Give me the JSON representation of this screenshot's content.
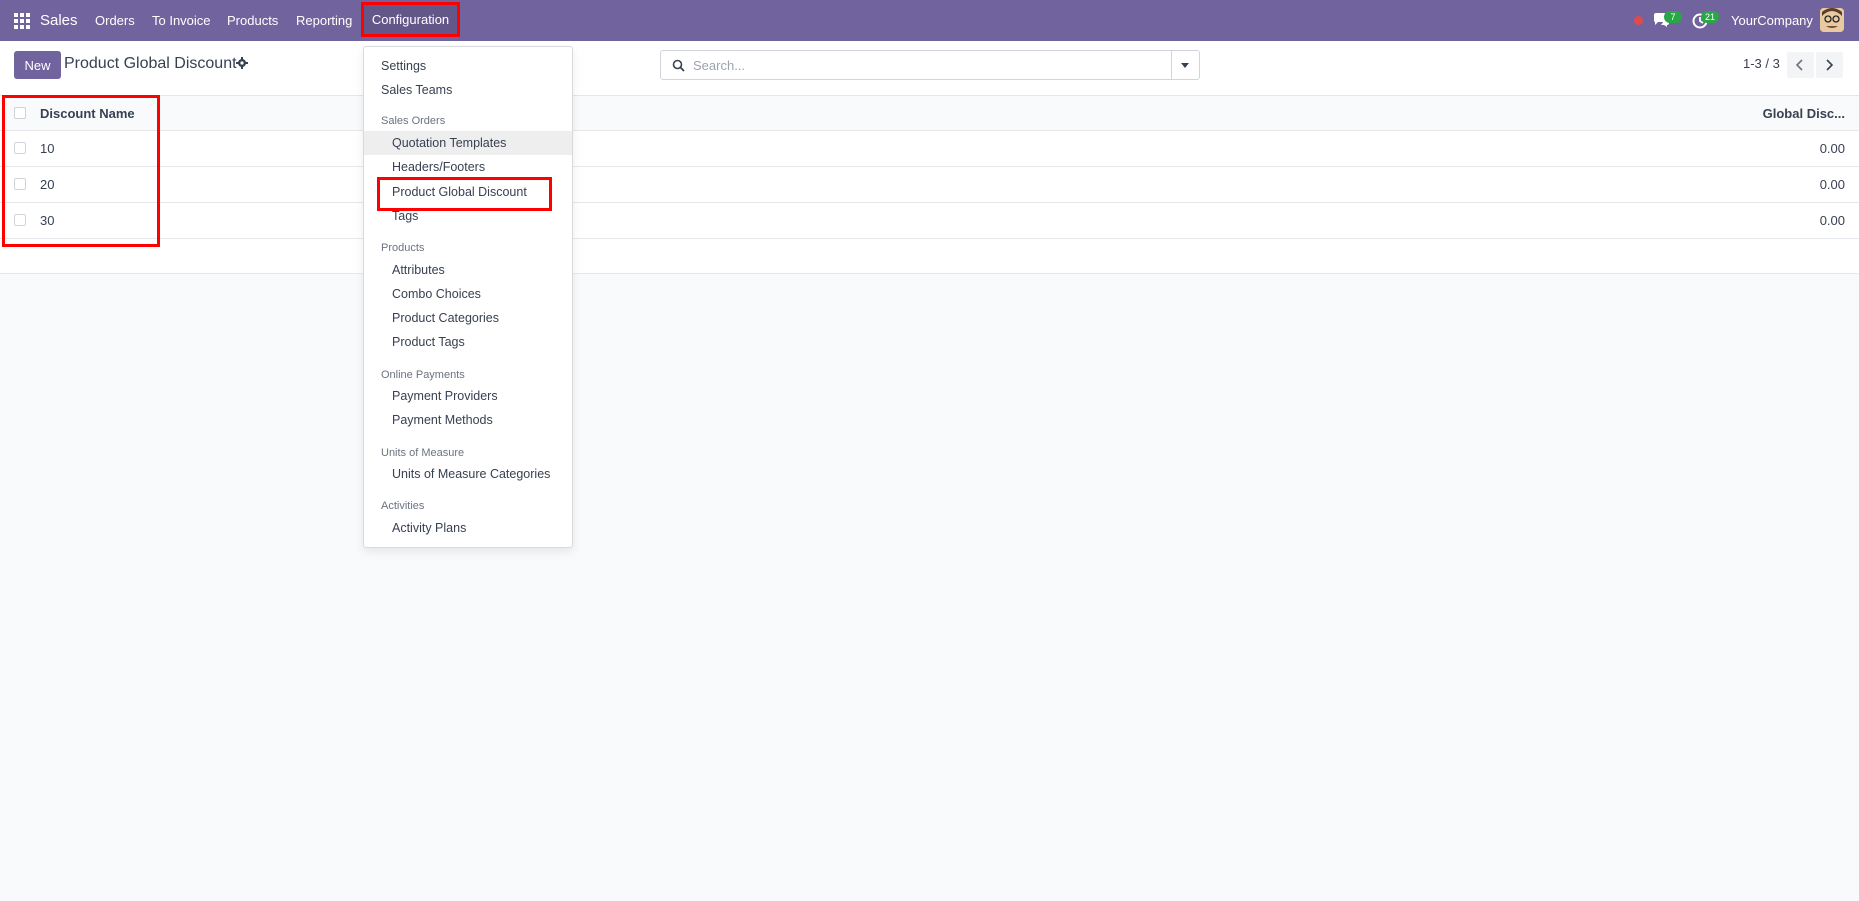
{
  "navbar": {
    "brand": "Sales",
    "menu": [
      "Orders",
      "To Invoice",
      "Products",
      "Reporting"
    ],
    "config_label": "Configuration",
    "chat_count": "7",
    "activity_count": "21",
    "company": "YourCompany"
  },
  "control": {
    "new_label": "New",
    "title": "Product Global Discount",
    "search_placeholder": "Search...",
    "pager": "1-3 / 3"
  },
  "table": {
    "columns": [
      "Discount Name",
      "Global Disc..."
    ],
    "rows": [
      {
        "name": "10",
        "value": "0.00"
      },
      {
        "name": "20",
        "value": "0.00"
      },
      {
        "name": "30",
        "value": "0.00"
      }
    ]
  },
  "dropdown": {
    "settings": "Settings",
    "sales_teams": "Sales Teams",
    "sales_orders_header": "Sales Orders",
    "quotation_templates": "Quotation Templates",
    "headers_footers": "Headers/Footers",
    "product_global_discount": "Product Global Discount",
    "tags": "Tags",
    "products_header": "Products",
    "attributes": "Attributes",
    "combo_choices": "Combo Choices",
    "product_categories": "Product Categories",
    "product_tags": "Product Tags",
    "online_payments_header": "Online Payments",
    "payment_providers": "Payment Providers",
    "payment_methods": "Payment Methods",
    "uom_header": "Units of Measure",
    "uom_categories": "Units of Measure Categories",
    "activities_header": "Activities",
    "activity_plans": "Activity Plans"
  },
  "colors": {
    "navbar": "#71639e",
    "primary_button": "#71639e",
    "badge": "#28a745",
    "highlight": "#ff0000"
  }
}
